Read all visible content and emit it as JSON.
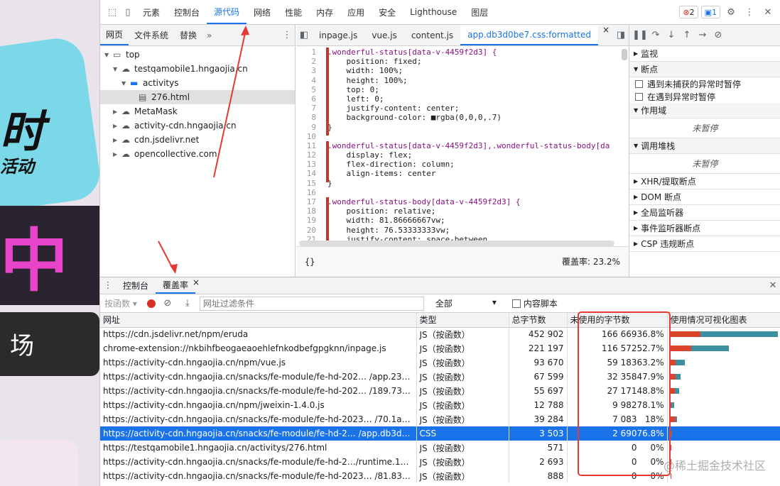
{
  "background_page": {
    "text1": "时",
    "text2": "活动",
    "text3": "中",
    "text4": "场"
  },
  "toolbar": {
    "tabs": [
      "元素",
      "控制台",
      "源代码",
      "网络",
      "性能",
      "内存",
      "应用",
      "安全",
      "Lighthouse",
      "图层"
    ],
    "active": "源代码",
    "error_count": "2",
    "info_count": "1"
  },
  "navigator": {
    "tabs": [
      "网页",
      "文件系统",
      "替换"
    ],
    "more": "»",
    "tree": [
      {
        "label": "top",
        "depth": 0,
        "arrow": "▼",
        "icon": "frame"
      },
      {
        "label": "testqamobile1.hngaojia.cn",
        "depth": 1,
        "arrow": "▼",
        "icon": "cloud"
      },
      {
        "label": "activitys",
        "depth": 2,
        "arrow": "▼",
        "icon": "folder"
      },
      {
        "label": "276.html",
        "depth": 3,
        "arrow": "",
        "icon": "file",
        "selected": true
      },
      {
        "label": "MetaMask",
        "depth": 1,
        "arrow": "▶",
        "icon": "cloud"
      },
      {
        "label": "activity-cdn.hngaojia.cn",
        "depth": 1,
        "arrow": "▶",
        "icon": "cloud"
      },
      {
        "label": "cdn.jsdelivr.net",
        "depth": 1,
        "arrow": "▶",
        "icon": "cloud"
      },
      {
        "label": "opencollective.com",
        "depth": 1,
        "arrow": "▶",
        "icon": "cloud"
      }
    ]
  },
  "editor": {
    "tabs": [
      "inpage.js",
      "vue.js",
      "content.js",
      "app.db3d0be7.css:formatted"
    ],
    "active": "app.db3d0be7.css:formatted",
    "lines": [
      ".wonderful-status[data-v-4459f2d3] {",
      "    position: fixed;",
      "    width: 100%;",
      "    height: 100%;",
      "    top: 0;",
      "    left: 0;",
      "    justify-content: center;",
      "    background-color: ■rgba(0,0,0,.7)",
      "}",
      "",
      ".wonderful-status[data-v-4459f2d3],.wonderful-status-body[da",
      "    display: flex;",
      "    flex-direction: column;",
      "    align-items: center",
      "}",
      "",
      ".wonderful-status-body[data-v-4459f2d3] {",
      "    position: relative;",
      "    width: 81.86666667vw;",
      "    height: 76.53333333vw;",
      "    justify-content: space-between"
    ],
    "footer_braces": "{}",
    "coverage_label": "覆盖率: 23.2%"
  },
  "debugger": {
    "sections": [
      {
        "label": "监视",
        "open": false
      },
      {
        "label": "断点",
        "open": true,
        "items": [
          "遇到未捕获的异常时暂停",
          "在遇到异常时暂停"
        ]
      },
      {
        "label": "作用域",
        "open": true,
        "empty": "未暂停"
      },
      {
        "label": "调用堆栈",
        "open": true,
        "empty": "未暂停"
      },
      {
        "label": "XHR/提取断点",
        "open": false
      },
      {
        "label": "DOM 断点",
        "open": false
      },
      {
        "label": "全局监听器",
        "open": false
      },
      {
        "label": "事件监听器断点",
        "open": false
      },
      {
        "label": "CSP 违规断点",
        "open": false
      }
    ]
  },
  "drawer": {
    "tabs": [
      "控制台",
      "覆盖率"
    ],
    "active": "覆盖率",
    "toolbar": {
      "per_function": "按函数",
      "url_filter_placeholder": "网址过滤条件",
      "type_filter": "全部",
      "content_scripts": "内容脚本"
    },
    "columns": [
      "网址",
      "类型",
      "总字节数",
      "未使用的字节数",
      "使用情况可视化图表"
    ],
    "rows": [
      {
        "url": "https://cdn.jsdelivr.net/npm/eruda",
        "type": "JS（按函数）",
        "total": "452 902",
        "unused": "166 669",
        "pct": "36.8%",
        "used_frac": 0.146,
        "unused_frac": 0.368
      },
      {
        "url": "chrome-extension://nkbihfbeogaeaoehlefnkodbefgpgknn/inpage.js",
        "type": "JS（按函数）",
        "total": "221 197",
        "unused": "116 572",
        "pct": "52.7%",
        "used_frac": 0.076,
        "unused_frac": 0.136
      },
      {
        "url": "https://activity-cdn.hngaojia.cn/npm/vue.js",
        "type": "JS（按函数）",
        "total": "93 670",
        "unused": "59 183",
        "pct": "63.2%",
        "used_frac": 0.019,
        "unused_frac": 0.033
      },
      {
        "url": "https://activity-cdn.hngaojia.cn/snacks/fe-module/fe-hd-202… /app.2398bd11.js",
        "type": "JS（按函数）",
        "total": "67 599",
        "unused": "32 358",
        "pct": "47.9%",
        "used_frac": 0.019,
        "unused_frac": 0.017
      },
      {
        "url": "https://activity-cdn.hngaojia.cn/snacks/fe-module/fe-hd-202… /189.73eddb57.js",
        "type": "JS（按函数）",
        "total": "55 697",
        "unused": "27 171",
        "pct": "48.8%",
        "used_frac": 0.016,
        "unused_frac": 0.015
      },
      {
        "url": "https://activity-cdn.hngaojia.cn/npm/jweixin-1.4.0.js",
        "type": "JS（按函数）",
        "total": "12 788",
        "unused": "9 982",
        "pct": "78.1%",
        "used_frac": 0.003,
        "unused_frac": 0.011
      },
      {
        "url": "https://activity-cdn.hngaojia.cn/snacks/fe-module/fe-hd-2023… /70.1ab8bc56.js",
        "type": "JS（按函数）",
        "total": "39 284",
        "unused": "7 083",
        "pct": "18%",
        "used_frac": 0.02,
        "unused_frac": 0.004
      },
      {
        "url": "https://activity-cdn.hngaojia.cn/snacks/fe-module/fe-hd-2… /app.db3d0be7.css",
        "type": "CSS",
        "total": "3 503",
        "unused": "2 690",
        "pct": "76.8%",
        "used_frac": 0.001,
        "unused_frac": 0.003,
        "selected": true
      },
      {
        "url": "https://testqamobile1.hngaojia.cn/activitys/276.html",
        "type": "JS（按函数）",
        "total": "571",
        "unused": "0",
        "pct": "0%",
        "used_frac": 0.002,
        "unused_frac": 0
      },
      {
        "url": "https://activity-cdn.hngaojia.cn/snacks/fe-module/fe-hd-2…/runtime.1bf25ad1.js",
        "type": "JS（按函数）",
        "total": "2 693",
        "unused": "0",
        "pct": "0%",
        "used_frac": 0.002,
        "unused_frac": 0
      },
      {
        "url": "https://activity-cdn.hngaojia.cn/snacks/fe-module/fe-hd-2023… /81.8303c54d.js",
        "type": "JS（按函数）",
        "total": "888",
        "unused": "0",
        "pct": "0%",
        "used_frac": 0.002,
        "unused_frac": 0
      }
    ]
  },
  "watermark": "@稀土掘金技术社区",
  "colors": {
    "accent": "#1a73e8",
    "used": "#d9452b",
    "unused": "#3e8fa0",
    "annotation": "#e53935"
  }
}
